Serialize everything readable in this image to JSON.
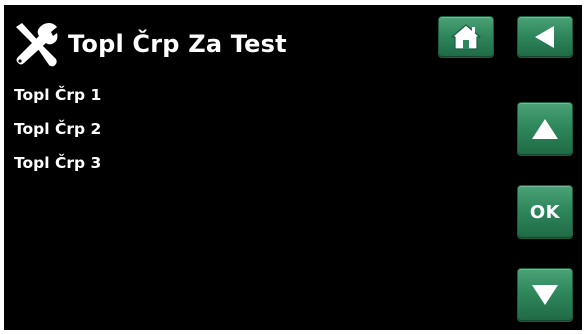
{
  "header": {
    "title": "Topl Črp Za Test",
    "icon": "tools-icon"
  },
  "menu": {
    "items": [
      {
        "label": "Topl Črp 1"
      },
      {
        "label": "Topl Črp 2"
      },
      {
        "label": "Topl Črp 3"
      }
    ]
  },
  "nav": {
    "home_icon": "home-icon",
    "back_icon": "back-arrow-icon",
    "up_icon": "up-arrow-icon",
    "ok_label": "OK",
    "down_icon": "down-arrow-icon"
  },
  "colors": {
    "background": "#000000",
    "text": "#ffffff",
    "button_green": "#2f875c"
  }
}
